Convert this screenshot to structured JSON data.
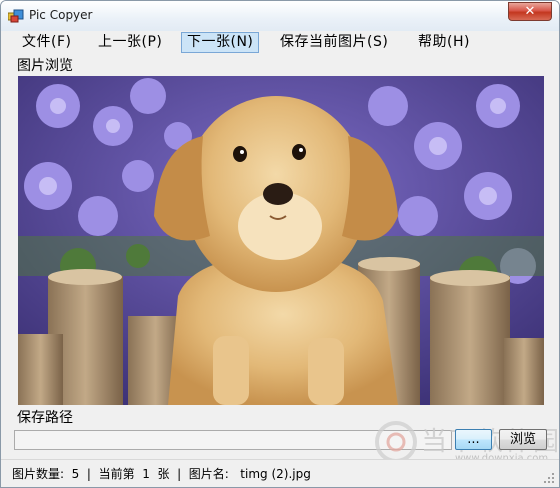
{
  "window": {
    "title": "Pic Copyer",
    "close_label": "✕"
  },
  "menu": {
    "items": [
      {
        "label": "文件(F)"
      },
      {
        "label": "上一张(P)"
      },
      {
        "label": "下一张(N)"
      },
      {
        "label": "保存当前图片(S)"
      },
      {
        "label": "帮助(H)"
      }
    ]
  },
  "preview": {
    "group_label": "图片浏览"
  },
  "save": {
    "group_label": "保存路径",
    "path_value": "",
    "pick_label": "...",
    "browse_label": "浏览"
  },
  "statusbar": {
    "text": "图片数量:  5  |  当前第  1  张  |  图片名:   timg (2).jpg"
  },
  "watermark": {
    "text": "当下软件园",
    "url": "www.downxia.com"
  }
}
